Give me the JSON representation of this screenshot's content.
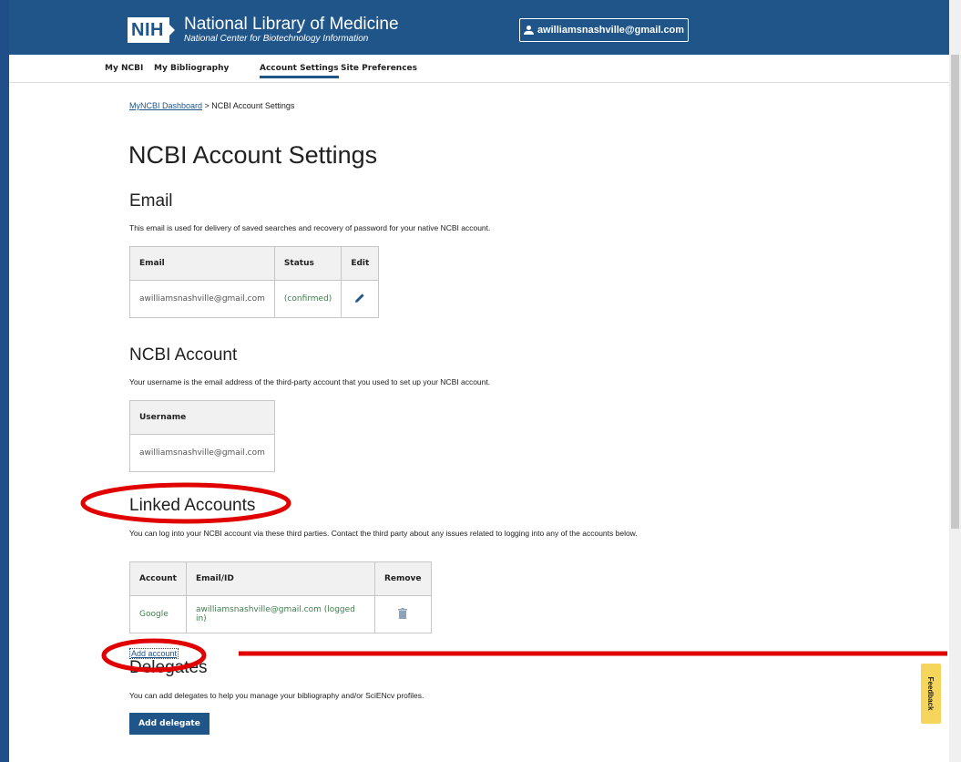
{
  "header": {
    "logo_badge": "NIH",
    "logo_title": "National Library of Medicine",
    "logo_subtitle": "National Center for Biotechnology Information",
    "user_email": "awilliamsnashville@gmail.com"
  },
  "nav": {
    "tabs": [
      {
        "label": "My NCBI"
      },
      {
        "label": "My Bibliography"
      },
      {
        "label": "Account Settings",
        "active": true
      },
      {
        "label": "Site Preferences"
      }
    ]
  },
  "breadcrumb": {
    "link": "MyNCBI Dashboard",
    "separator": " > ",
    "current": "NCBI Account Settings"
  },
  "page_title": "NCBI Account Settings",
  "email_section": {
    "heading": "Email",
    "description": "This email is used for delivery of saved searches and recovery of password for your native NCBI account.",
    "headers": [
      "Email",
      "Status",
      "Edit"
    ],
    "rows": [
      {
        "email": "awilliamsnashville@gmail.com",
        "status": "(confirmed)"
      }
    ]
  },
  "account_section": {
    "heading": "NCBI Account",
    "description": "Your username is the email address of the third-party account that you used to set up your NCBI account.",
    "headers": [
      "Username"
    ],
    "rows": [
      {
        "username": "awilliamsnashville@gmail.com"
      }
    ]
  },
  "linked_section": {
    "heading": "Linked Accounts",
    "description": "You can log into your NCBI account via these third parties. Contact the third party about any issues related to logging into any of the accounts below.",
    "headers": [
      "Account",
      "Email/ID",
      "Remove"
    ],
    "rows": [
      {
        "account": "Google",
        "email_id": "awilliamsnashville@gmail.com (logged in)"
      }
    ],
    "add_link": "Add account"
  },
  "delegates_section": {
    "heading": "Delegates",
    "description": "You can add delegates to help you manage your bibliography and/or SciENcv profiles.",
    "add_button": "Add delegate"
  },
  "feedback_label": "Feedback",
  "colors": {
    "header_bg": "#20558a",
    "link": "#20558a",
    "status_green": "#3e7d4b",
    "annotation_red": "#e00000",
    "feedback_bg": "#f6d55c"
  }
}
